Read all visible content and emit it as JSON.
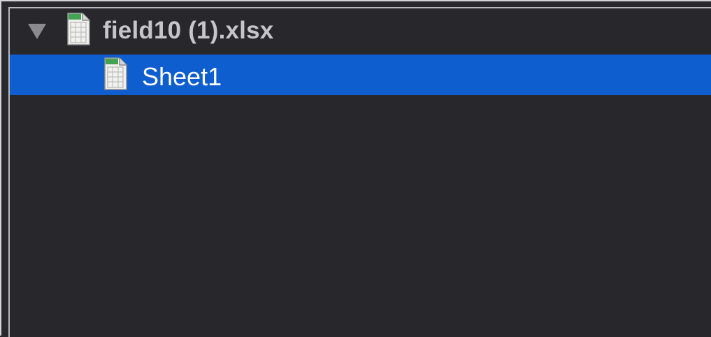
{
  "tree": {
    "file": {
      "label": "field10 (1).xlsx",
      "icon": "spreadsheet-file-icon",
      "expanded": true
    },
    "items": [
      {
        "label": "Sheet1",
        "icon": "spreadsheet-sheet-icon",
        "selected": true
      }
    ]
  },
  "colors": {
    "background": "#29282d",
    "selection": "#0f5ecf",
    "text": "#c6c6ca",
    "selected_text": "#ffffff",
    "icon_green": "#41a653"
  }
}
